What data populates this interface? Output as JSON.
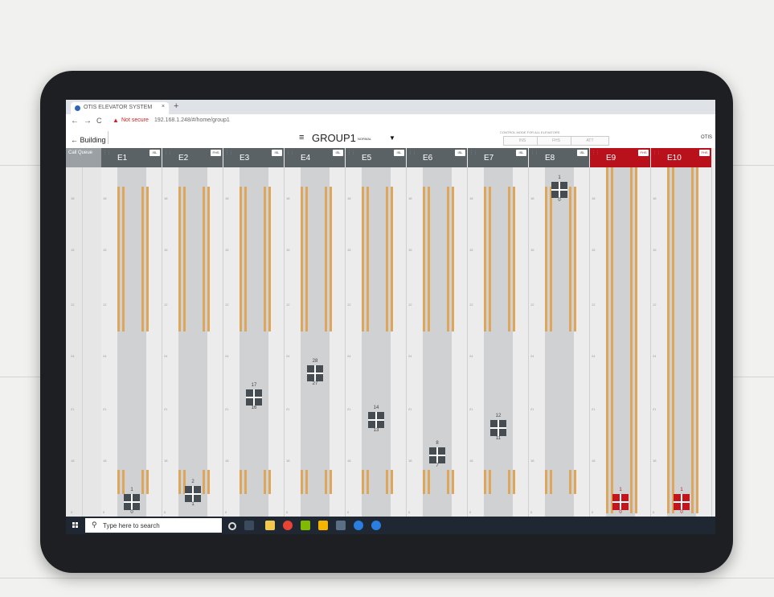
{
  "browser": {
    "tab_title": "OTIS ELEVATOR SYSTEM",
    "tab_close": "×",
    "new_tab": "+",
    "back": "←",
    "forward": "→",
    "reload": "C",
    "security_text": "Not secure",
    "url": "192.168.1.248/#/home/group1"
  },
  "app": {
    "back_label": "← Building",
    "menu_icon": "≡",
    "group_title": "GROUP1",
    "mode_label": "NORMAL",
    "mode_caret": "▼",
    "modes_caption": "CONTROL MODE FOR ALL ELEVATORS",
    "mode_buttons": [
      "INS",
      "FHS",
      "ATT"
    ],
    "brand": "OTIS",
    "call_header": "Call Queue",
    "floor_labels": [
      "18",
      "15",
      "12",
      "24",
      "21",
      "18",
      "15",
      "0"
    ]
  },
  "elevators": [
    {
      "name": "E1",
      "mode": "ISL",
      "red": false,
      "shaft_labels": [
        "18",
        "15",
        "12",
        "24",
        "21",
        "18",
        "15",
        "0"
      ],
      "car_top": "1",
      "car_bottom": "0"
    },
    {
      "name": "E2",
      "mode": "FHS",
      "red": false,
      "shaft_labels": [
        "18",
        "15",
        "12",
        "24",
        "21",
        "18",
        "15",
        "0"
      ],
      "car_top": "2",
      "car_bottom": "1"
    },
    {
      "name": "E3",
      "mode": "ISL",
      "red": false,
      "shaft_labels": [
        "18",
        "15",
        "12",
        "24",
        "21",
        "18",
        "15",
        "0"
      ],
      "car_top": "17",
      "car_bottom": "16"
    },
    {
      "name": "E4",
      "mode": "ISL",
      "red": false,
      "shaft_labels": [
        "18",
        "15",
        "12",
        "24",
        "21",
        "18",
        "15",
        "0"
      ],
      "car_top": "28",
      "car_bottom": "27"
    },
    {
      "name": "E5",
      "mode": "ISL",
      "red": false,
      "shaft_labels": [
        "18",
        "15",
        "12",
        "24",
        "21",
        "18",
        "15",
        "0"
      ],
      "car_top": "14",
      "car_bottom": "13"
    },
    {
      "name": "E6",
      "mode": "ISL",
      "red": false,
      "shaft_labels": [
        "18",
        "15",
        "12",
        "24",
        "21",
        "18",
        "15",
        "0"
      ],
      "car_top": "8",
      "car_bottom": "7"
    },
    {
      "name": "E7",
      "mode": "ISL",
      "red": false,
      "shaft_labels": [
        "18",
        "15",
        "12",
        "24",
        "21",
        "18",
        "15",
        "0"
      ],
      "car_top": "12",
      "car_bottom": "11"
    },
    {
      "name": "E8",
      "mode": "ISL",
      "red": false,
      "shaft_labels": [
        "18",
        "15",
        "12",
        "24",
        "21",
        "18",
        "15",
        "0"
      ],
      "car_top": "1",
      "car_bottom": "0"
    },
    {
      "name": "E9",
      "mode": "FHS",
      "red": true,
      "shaft_labels": [
        "18",
        "15",
        "12",
        "24",
        "21",
        "18",
        "15",
        "0"
      ],
      "car_top": "1",
      "car_bottom": "0"
    },
    {
      "name": "E10",
      "mode": "FHS",
      "red": true,
      "shaft_labels": [
        "18",
        "15",
        "12",
        "24",
        "21",
        "18",
        "15",
        "0"
      ],
      "car_top": "1",
      "car_bottom": "0"
    }
  ],
  "taskbar": {
    "search_placeholder": "Type here to search",
    "search_icon": "magnifier-icon"
  },
  "colors": {
    "header_grey": "#5b6266",
    "alarm_red": "#b8111c",
    "rail_orange": "#dda65a",
    "shaft_grey": "#cfd1d2"
  }
}
